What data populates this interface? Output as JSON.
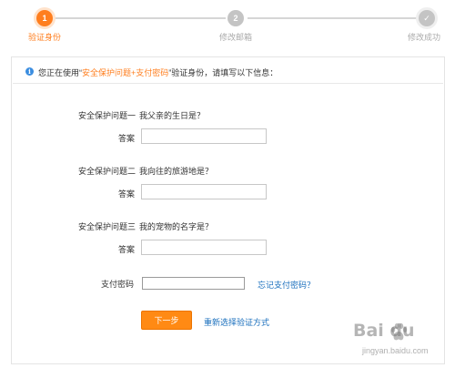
{
  "steps": {
    "step1": {
      "number": "1",
      "label": "验证身份"
    },
    "step2": {
      "number": "2",
      "label": "修改邮箱"
    },
    "step3": {
      "number": "✓",
      "label": "修改成功"
    }
  },
  "info": {
    "prefix": "您正在使用“",
    "method": "安全保护问题+支付密码",
    "suffix": "”验证身份，请填写以下信息："
  },
  "questions": [
    {
      "label": "安全保护问题一",
      "question": "我父亲的生日是？",
      "answer_label": "答案",
      "answer_value": ""
    },
    {
      "label": "安全保护问题二",
      "question": "我向往的旅游地是？",
      "answer_label": "答案",
      "answer_value": ""
    },
    {
      "label": "安全保护问题三",
      "question": "我的宠物的名字是？",
      "answer_label": "答案",
      "answer_value": ""
    }
  ],
  "payment": {
    "label": "支付密码",
    "value": "",
    "forgot_link": "忘记支付密码？"
  },
  "actions": {
    "next_label": "下一步",
    "reselect_link": "重新选择验证方式"
  },
  "watermark": {
    "logo_text": "Bai du",
    "url": "jingyan.baidu.com"
  },
  "colors": {
    "accent": "#ff7e1e",
    "button": "#ff8a14",
    "link": "#1a6fbd",
    "info_icon": "#3a8de0",
    "inactive": "#c4c4c4"
  }
}
